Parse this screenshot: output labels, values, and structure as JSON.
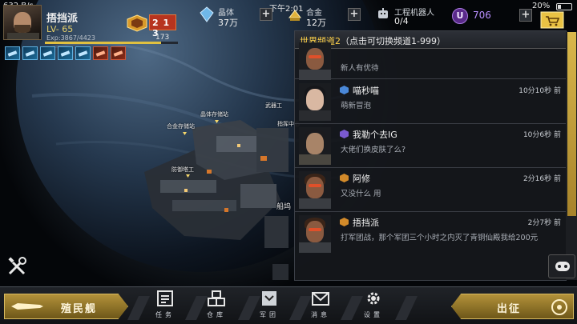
{
  "status_bar": {
    "network": "632 B/s",
    "time": "下午2:01",
    "battery": "20%"
  },
  "player": {
    "name": "捂挡派",
    "level": "LV- 65",
    "exp": "Exp:3867/4423",
    "exp_progress": 0.874,
    "rank_digits": "2 1 3",
    "rank_value": "173"
  },
  "resources": {
    "crystal": {
      "label": "晶体",
      "value": "37万"
    },
    "alloy": {
      "label": "合金",
      "value": "12万"
    },
    "robots": {
      "label": "工程机器人",
      "value": "0/4"
    },
    "gems": {
      "icon": "U",
      "value": "706"
    }
  },
  "station_labels": [
    "晶体存储站",
    "合金存储站",
    "防御塔工",
    "合金存储站",
    "武器工",
    "指挥中心",
    "船坞"
  ],
  "chat": {
    "header_channel": "世界频道2",
    "header_hint": "（点击可切换频道1-999）",
    "messages": [
      {
        "name": "",
        "time": "",
        "text": "新人有优待",
        "rank_color": "#d28a2a"
      },
      {
        "name": "喵秒喵",
        "time": "10分10秒 前",
        "text": "萌新冒泡",
        "rank_color": "#4a88d8"
      },
      {
        "name": "我勒个去IG",
        "time": "10分6秒 前",
        "text": "大佬们换皮肤了么?",
        "rank_color": "#7a5ad0"
      },
      {
        "name": "阿修",
        "time": "2分16秒 前",
        "text": "又没什么 用",
        "rank_color": "#d28a2a"
      },
      {
        "name": "捂挡派",
        "time": "2分7秒 前",
        "text": "打军团战，那个军团三个小时之内灭了青铜仙殿我给200元",
        "rank_color": "#d28a2a"
      }
    ]
  },
  "bottom_nav": {
    "colony": "殖民舰",
    "items": [
      {
        "label": "任务",
        "icon": "task-icon"
      },
      {
        "label": "仓库",
        "icon": "warehouse-icon"
      },
      {
        "label": "军团",
        "icon": "legion-icon"
      },
      {
        "label": "消息",
        "icon": "mail-icon"
      },
      {
        "label": "设置",
        "icon": "settings-icon"
      }
    ],
    "deploy": "出征"
  },
  "colors": {
    "gold": "#d9bb60",
    "accent_yellow": "#ffd24a",
    "gem_purple": "#b98fff"
  }
}
